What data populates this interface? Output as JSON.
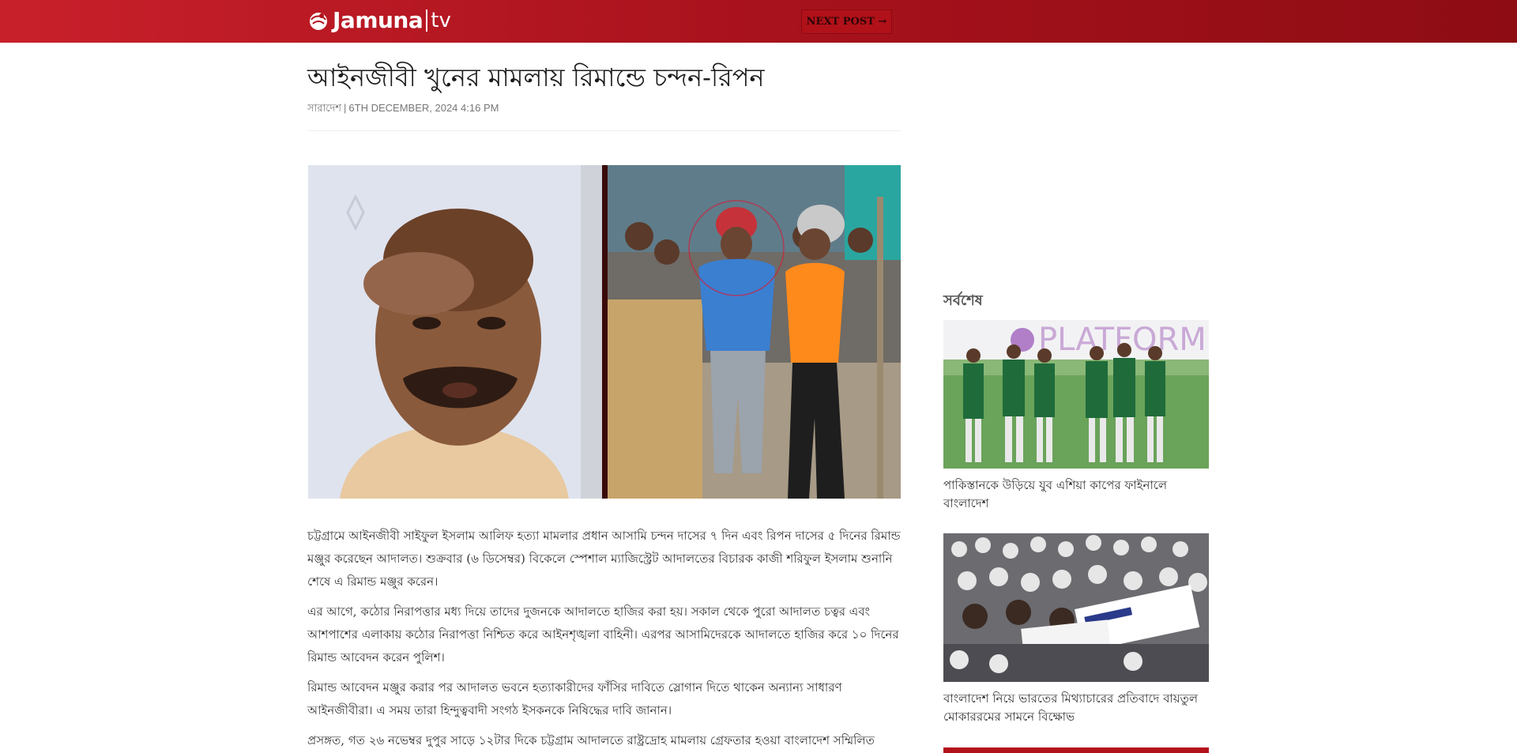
{
  "header": {
    "logo_text": "Jamuna",
    "logo_suffix": "tv",
    "next_post_label": "NEXT POST →"
  },
  "article": {
    "headline": "আইনজীবী খুনের মামলায় রিমান্ডে চন্দন-রিপন",
    "category": "সারাদেশ",
    "date": "6TH DECEMBER, 2024 4:16 PM",
    "paragraphs": [
      "চট্টগ্রামে আইনজীবী সাইফুল ইসলাম আলিফ হত্যা মামলার প্রধান আসামি চন্দন দাসের ৭ দিন এবং রিপন দাসের ৫ দিনের রিমান্ড মঞ্জুর করেছেন আদালত। শুক্রবার (৬ ডিসেম্বর) বিকেলে স্পেশাল ম্যাজিস্ট্রেট আদালতের বিচারক কাজী শরিফুল ইসলাম শুনানি শেষে এ রিমান্ড মঞ্জুর করেন।",
      "এর আগে, কঠোর নিরাপত্তার মধ্য দিয়ে তাদের দুজনকে আদালতে হাজির করা হয়। সকাল থেকে পুরো আদালত চত্বর এবং আশপাশের এলাকায় কঠোর নিরাপত্তা নিশ্চিত করে আইনশৃঙ্খলা বাহিনী। এরপর আসামিদেরকে আদালতে হাজির করে ১০ দিনের রিমান্ড আবেদন করেন পুলিশ।",
      "রিমান্ড আবেদন মঞ্জুর করার পর আদালত ভবনে হত্যাকারীদের ফাঁসির দাবিতে স্লোগান দিতে থাকেন অন্যান্য সাধারণ আইনজীবীরা। এ সময় তারা হিন্দুত্ববাদী সংগঠ ইসকনকে নিষিদ্ধের দাবি জানান।",
      "প্রসঙ্গত, গত ২৬ নভেম্বর দুপুর সাড়ে ১২টার দিকে চট্টগ্রাম আদালতে রাষ্ট্রদ্রোহ মামলায় গ্রেফতার হওয়া বাংলাদেশ সম্মিলিত"
    ]
  },
  "sidebar": {
    "title": "সর্বশেষ",
    "cards": [
      {
        "title": "পাকিস্তানকে উড়িয়ে যুব এশিয়া কাপের ফাইনালে বাংলাদেশ",
        "banner_text": "PLATFORM"
      },
      {
        "title": "বাংলাদেশ নিয়ে ভারতের মিথ্যাচারের প্রতিবাদে বায়তুল মোকাররমের সামনে বিক্ষোভ"
      }
    ]
  },
  "colors": {
    "brand_red": "#c8202b",
    "brand_dark_red": "#8e0c14"
  }
}
